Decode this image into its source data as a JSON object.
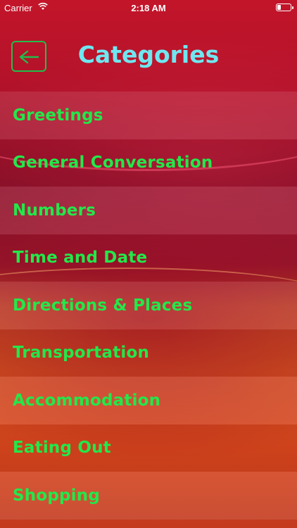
{
  "status_bar": {
    "carrier": "Carrier",
    "time": "2:18 AM"
  },
  "header": {
    "title": "Categories",
    "back_icon": "back-arrow-icon"
  },
  "categories": [
    {
      "label": "Greetings"
    },
    {
      "label": "General Conversation"
    },
    {
      "label": "Numbers"
    },
    {
      "label": "Time and Date"
    },
    {
      "label": "Directions & Places"
    },
    {
      "label": "Transportation"
    },
    {
      "label": "Accommodation"
    },
    {
      "label": "Eating Out"
    },
    {
      "label": "Shopping"
    }
  ],
  "colors": {
    "title": "#6ee7f0",
    "category_text": "#22e84a",
    "back_button": "#1fbf4a"
  }
}
